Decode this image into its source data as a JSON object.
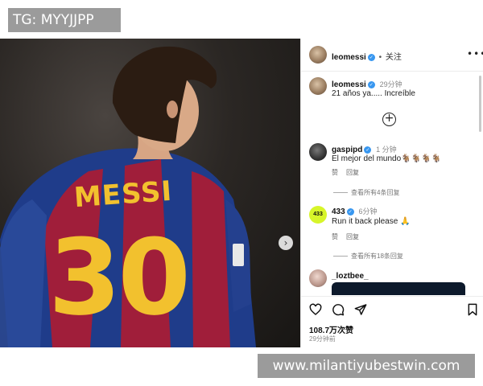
{
  "watermarks": {
    "top": "TG: MYYJJPP",
    "bottom": "www.milantiyubestwin.com"
  },
  "photo": {
    "jersey_name": "MESSI",
    "jersey_number": "30"
  },
  "post": {
    "header_username": "leomessi",
    "separator": "•",
    "follow_label": "关注",
    "caption_username": "leomessi",
    "caption_time": "29分钟",
    "caption_text": "21 años ya..... Increíble",
    "likes": "108.7万次赞",
    "time": "29分钟前"
  },
  "comments": [
    {
      "username": "gaspipd",
      "time": "1 分钟",
      "text": "El mejor del mundo🐐🐐🐐🐐",
      "like_label": "赞",
      "reply_label": "回复",
      "view_replies": "查看所有4条回复"
    },
    {
      "username": "433",
      "avatar_text": "433",
      "time": "6分钟",
      "text": "Run it back please 🙏",
      "like_label": "赞",
      "reply_label": "回复",
      "view_replies": "查看所有18条回复"
    },
    {
      "username": "_loztbee_"
    }
  ],
  "icons": {
    "more": "more-horizontal-icon",
    "add": "plus-circle-icon",
    "like": "heart-icon",
    "comment": "comment-icon",
    "share": "send-icon",
    "save": "bookmark-icon",
    "next": "chevron-right-icon"
  },
  "colors": {
    "verified": "#3897f0",
    "jersey_red": "#a01e3a",
    "jersey_blue": "#1f3c8a",
    "jersey_yellow": "#f2c12e"
  }
}
